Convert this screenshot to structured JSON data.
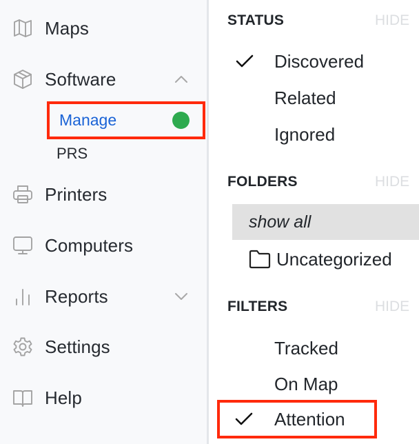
{
  "sidebar": {
    "items": [
      {
        "label": "Maps",
        "icon": "map-icon"
      },
      {
        "label": "Software",
        "icon": "package-icon",
        "expanded": true,
        "children": [
          {
            "label": "Manage",
            "active": true,
            "status_color": "#2eaa4f"
          },
          {
            "label": "PRS",
            "active": false
          }
        ]
      },
      {
        "label": "Printers",
        "icon": "printer-icon"
      },
      {
        "label": "Computers",
        "icon": "monitor-icon"
      },
      {
        "label": "Reports",
        "icon": "bar-chart-icon",
        "expanded": false
      },
      {
        "label": "Settings",
        "icon": "gear-icon"
      },
      {
        "label": "Help",
        "icon": "book-icon"
      }
    ]
  },
  "panel": {
    "status": {
      "title": "STATUS",
      "hide_label": "HIDE",
      "options": [
        {
          "label": "Discovered",
          "checked": true
        },
        {
          "label": "Related",
          "checked": false
        },
        {
          "label": "Ignored",
          "checked": false
        }
      ]
    },
    "folders": {
      "title": "FOLDERS",
      "hide_label": "HIDE",
      "show_all_label": "show all",
      "items": [
        {
          "label": "Uncategorized",
          "icon": "folder-icon"
        }
      ]
    },
    "filters": {
      "title": "FILTERS",
      "hide_label": "HIDE",
      "options": [
        {
          "label": "Tracked",
          "checked": false
        },
        {
          "label": "On Map",
          "checked": false
        },
        {
          "label": "Attention",
          "checked": true
        }
      ]
    }
  },
  "colors": {
    "active_link": "#1a63d6",
    "status_dot": "#2eaa4f",
    "highlight": "#ff2a0c",
    "selected_row": "#e1e1e1"
  }
}
